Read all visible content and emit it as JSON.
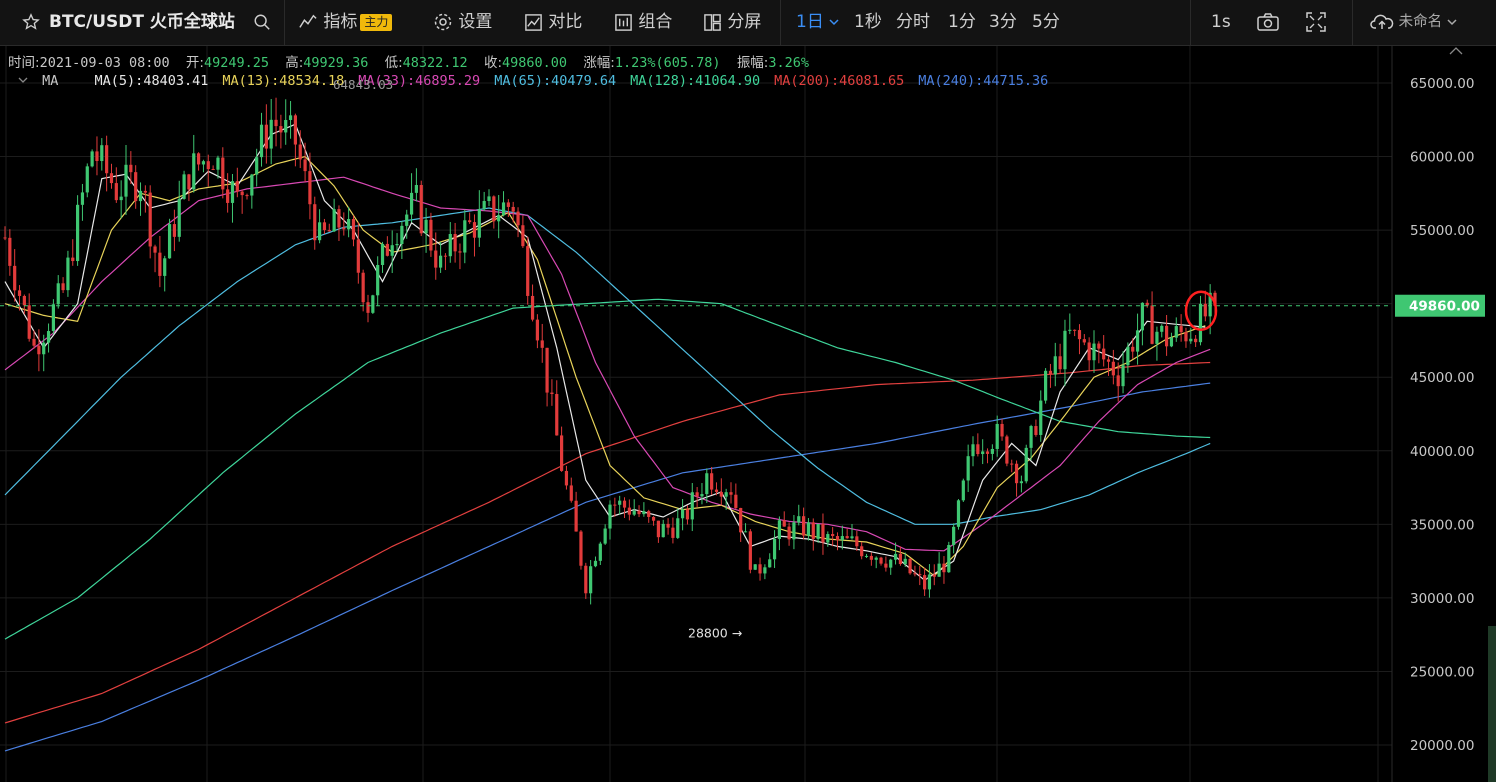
{
  "toolbar": {
    "symbol": "BTC/USDT 火币全球站",
    "indicators": "指标",
    "indicators_badge": "主力",
    "settings": "设置",
    "compare": "对比",
    "combine": "组合",
    "split": "分屏",
    "intervals": [
      "1日",
      "1秒",
      "分时",
      "1分",
      "3分",
      "5分"
    ],
    "active_interval": "1日",
    "replay": "1s",
    "layout_name": "未命名"
  },
  "info": {
    "time_label": "时间:",
    "time": "2021-09-03 08:00",
    "open_label": "开:",
    "open": "49249.25",
    "high_label": "高:",
    "high": "49929.36",
    "low_label": "低:",
    "low": "48322.12",
    "close_label": "收:",
    "close": "49860.00",
    "change_label": "涨幅:",
    "change": "1.23%(605.78)",
    "amp_label": "振幅:",
    "amp": "3.26%"
  },
  "ma_legend": {
    "title": "MA",
    "items": [
      {
        "label": "MA(5):48403.41",
        "color": "#e8e8e8"
      },
      {
        "label": "MA(13):48534.18",
        "color": "#e8d35a"
      },
      {
        "label": "MA(33):46895.29",
        "color": "#d849b4"
      },
      {
        "label": "MA(65):40479.64",
        "color": "#4fbde0"
      },
      {
        "label": "MA(128):41064.90",
        "color": "#3fd59a"
      },
      {
        "label": "MA(200):46081.65",
        "color": "#e2403f"
      },
      {
        "label": "MA(240):44715.36",
        "color": "#4a7fe0"
      }
    ],
    "overlap_text": "64843.03"
  },
  "chart_data": {
    "type": "candlestick",
    "ylim": [
      19000,
      67000
    ],
    "yticks": [
      "65000.00",
      "60000.00",
      "55000.00",
      "50000.00",
      "45000.00",
      "40000.00",
      "35000.00",
      "30000.00",
      "25000.00",
      "20000.00"
    ],
    "ytick_values": [
      65000,
      60000,
      55000,
      50000,
      45000,
      40000,
      35000,
      30000,
      25000,
      20000
    ],
    "last_price": 49860,
    "last_price_label": "49860.00",
    "low_annotation": {
      "value": 28800,
      "label": "28800 →"
    },
    "colors": {
      "up": "#3fc772",
      "down": "#e23b3b",
      "price_line": "#3fc772",
      "circle": "#ff2020"
    },
    "price_path": [
      [
        0,
        54500
      ],
      [
        6,
        47000
      ],
      [
        12,
        50800
      ],
      [
        18,
        60500
      ],
      [
        23,
        57800
      ],
      [
        28,
        58500
      ],
      [
        32,
        52000
      ],
      [
        38,
        59000
      ],
      [
        43,
        60200
      ],
      [
        48,
        57000
      ],
      [
        55,
        62500
      ],
      [
        60,
        61000
      ],
      [
        65,
        54200
      ],
      [
        70,
        55800
      ],
      [
        75,
        50000
      ],
      [
        80,
        55000
      ],
      [
        85,
        56800
      ],
      [
        90,
        52500
      ],
      [
        95,
        55000
      ],
      [
        100,
        56200
      ],
      [
        105,
        56800
      ],
      [
        110,
        48500
      ],
      [
        115,
        39000
      ],
      [
        120,
        31000
      ],
      [
        125,
        36500
      ],
      [
        130,
        36000
      ],
      [
        135,
        34500
      ],
      [
        140,
        35200
      ],
      [
        145,
        38300
      ],
      [
        150,
        37500
      ],
      [
        155,
        31500
      ],
      [
        160,
        34500
      ],
      [
        165,
        34800
      ],
      [
        170,
        33900
      ],
      [
        175,
        33700
      ],
      [
        180,
        33000
      ],
      [
        185,
        32300
      ],
      [
        190,
        30800
      ],
      [
        195,
        32800
      ],
      [
        200,
        40500
      ],
      [
        205,
        41000
      ],
      [
        210,
        38200
      ],
      [
        215,
        44500
      ],
      [
        220,
        47800
      ],
      [
        225,
        46800
      ],
      [
        230,
        45300
      ],
      [
        235,
        49000
      ],
      [
        240,
        47600
      ],
      [
        245,
        48200
      ],
      [
        250,
        49860
      ]
    ],
    "ma": [
      {
        "name": "MA(5)",
        "color": "#e8e8e8",
        "pts": [
          [
            0,
            51500
          ],
          [
            8,
            47000
          ],
          [
            15,
            50000
          ],
          [
            20,
            58500
          ],
          [
            25,
            58800
          ],
          [
            30,
            56500
          ],
          [
            36,
            57000
          ],
          [
            42,
            59000
          ],
          [
            48,
            58000
          ],
          [
            55,
            61500
          ],
          [
            60,
            62200
          ],
          [
            66,
            57000
          ],
          [
            72,
            55000
          ],
          [
            78,
            51500
          ],
          [
            84,
            55500
          ],
          [
            90,
            54000
          ],
          [
            96,
            55000
          ],
          [
            102,
            56000
          ],
          [
            108,
            54500
          ],
          [
            114,
            47000
          ],
          [
            120,
            38000
          ],
          [
            125,
            35500
          ],
          [
            130,
            36000
          ],
          [
            136,
            35500
          ],
          [
            142,
            36500
          ],
          [
            148,
            37200
          ],
          [
            154,
            33500
          ],
          [
            160,
            34200
          ],
          [
            166,
            34000
          ],
          [
            172,
            33500
          ],
          [
            178,
            33200
          ],
          [
            184,
            32800
          ],
          [
            190,
            31200
          ],
          [
            196,
            32500
          ],
          [
            202,
            38000
          ],
          [
            208,
            40500
          ],
          [
            213,
            39000
          ],
          [
            218,
            44000
          ],
          [
            224,
            47000
          ],
          [
            230,
            46200
          ],
          [
            236,
            48800
          ],
          [
            242,
            48600
          ],
          [
            248,
            48400
          ]
        ]
      },
      {
        "name": "MA(13)",
        "color": "#e8d35a",
        "pts": [
          [
            0,
            50000
          ],
          [
            8,
            49200
          ],
          [
            15,
            48800
          ],
          [
            22,
            55000
          ],
          [
            28,
            57500
          ],
          [
            34,
            57000
          ],
          [
            40,
            57800
          ],
          [
            48,
            58200
          ],
          [
            56,
            59500
          ],
          [
            62,
            60000
          ],
          [
            68,
            58000
          ],
          [
            74,
            55000
          ],
          [
            80,
            53500
          ],
          [
            88,
            54000
          ],
          [
            96,
            54800
          ],
          [
            104,
            56200
          ],
          [
            110,
            53000
          ],
          [
            118,
            45000
          ],
          [
            125,
            39000
          ],
          [
            132,
            36800
          ],
          [
            140,
            36000
          ],
          [
            148,
            36300
          ],
          [
            155,
            35200
          ],
          [
            162,
            34500
          ],
          [
            170,
            34000
          ],
          [
            178,
            33800
          ],
          [
            186,
            33000
          ],
          [
            192,
            31500
          ],
          [
            198,
            33500
          ],
          [
            205,
            37500
          ],
          [
            212,
            39500
          ],
          [
            218,
            42000
          ],
          [
            225,
            45000
          ],
          [
            232,
            46000
          ],
          [
            240,
            47600
          ],
          [
            248,
            48500
          ]
        ]
      },
      {
        "name": "MA(33)",
        "color": "#d849b4",
        "pts": [
          [
            0,
            45500
          ],
          [
            10,
            48000
          ],
          [
            20,
            51500
          ],
          [
            30,
            54500
          ],
          [
            40,
            57000
          ],
          [
            50,
            57800
          ],
          [
            60,
            58200
          ],
          [
            70,
            58600
          ],
          [
            80,
            57500
          ],
          [
            90,
            56500
          ],
          [
            100,
            56300
          ],
          [
            108,
            56000
          ],
          [
            115,
            52000
          ],
          [
            122,
            46000
          ],
          [
            130,
            41000
          ],
          [
            138,
            37500
          ],
          [
            146,
            36500
          ],
          [
            154,
            35700
          ],
          [
            162,
            35200
          ],
          [
            170,
            35000
          ],
          [
            178,
            34500
          ],
          [
            186,
            33300
          ],
          [
            194,
            33200
          ],
          [
            202,
            35000
          ],
          [
            210,
            37000
          ],
          [
            218,
            39000
          ],
          [
            226,
            42000
          ],
          [
            234,
            44500
          ],
          [
            242,
            46000
          ],
          [
            249,
            46900
          ]
        ]
      },
      {
        "name": "MA(65)",
        "color": "#4fbde0",
        "pts": [
          [
            0,
            37000
          ],
          [
            12,
            41000
          ],
          [
            24,
            45000
          ],
          [
            36,
            48500
          ],
          [
            48,
            51500
          ],
          [
            60,
            54000
          ],
          [
            70,
            55200
          ],
          [
            80,
            55500
          ],
          [
            90,
            56000
          ],
          [
            100,
            56500
          ],
          [
            108,
            56000
          ],
          [
            118,
            53500
          ],
          [
            128,
            50500
          ],
          [
            138,
            47500
          ],
          [
            148,
            44500
          ],
          [
            158,
            41500
          ],
          [
            168,
            38800
          ],
          [
            178,
            36500
          ],
          [
            188,
            35000
          ],
          [
            196,
            35000
          ],
          [
            204,
            35500
          ],
          [
            214,
            36000
          ],
          [
            224,
            37000
          ],
          [
            234,
            38500
          ],
          [
            244,
            39800
          ],
          [
            249,
            40500
          ]
        ]
      },
      {
        "name": "MA(128)",
        "color": "#3fd59a",
        "pts": [
          [
            0,
            27200
          ],
          [
            15,
            30000
          ],
          [
            30,
            34000
          ],
          [
            45,
            38500
          ],
          [
            60,
            42500
          ],
          [
            75,
            46000
          ],
          [
            90,
            48000
          ],
          [
            105,
            49700
          ],
          [
            120,
            50000
          ],
          [
            135,
            50300
          ],
          [
            148,
            50000
          ],
          [
            160,
            48500
          ],
          [
            172,
            47000
          ],
          [
            184,
            46000
          ],
          [
            196,
            44800
          ],
          [
            206,
            43500
          ],
          [
            218,
            42000
          ],
          [
            230,
            41300
          ],
          [
            242,
            41000
          ],
          [
            249,
            40900
          ]
        ]
      },
      {
        "name": "MA(200)",
        "color": "#e2403f",
        "pts": [
          [
            0,
            21500
          ],
          [
            20,
            23500
          ],
          [
            40,
            26500
          ],
          [
            60,
            30000
          ],
          [
            80,
            33500
          ],
          [
            100,
            36500
          ],
          [
            120,
            39800
          ],
          [
            140,
            42000
          ],
          [
            160,
            43800
          ],
          [
            180,
            44500
          ],
          [
            200,
            44800
          ],
          [
            220,
            45300
          ],
          [
            235,
            45800
          ],
          [
            249,
            46000
          ]
        ]
      },
      {
        "name": "MA(240)",
        "color": "#4a7fe0",
        "pts": [
          [
            0,
            19600
          ],
          [
            20,
            21600
          ],
          [
            40,
            24400
          ],
          [
            60,
            27400
          ],
          [
            80,
            30500
          ],
          [
            100,
            33500
          ],
          [
            120,
            36500
          ],
          [
            140,
            38500
          ],
          [
            160,
            39500
          ],
          [
            180,
            40500
          ],
          [
            200,
            41800
          ],
          [
            220,
            43000
          ],
          [
            235,
            44000
          ],
          [
            249,
            44600
          ]
        ]
      }
    ]
  }
}
